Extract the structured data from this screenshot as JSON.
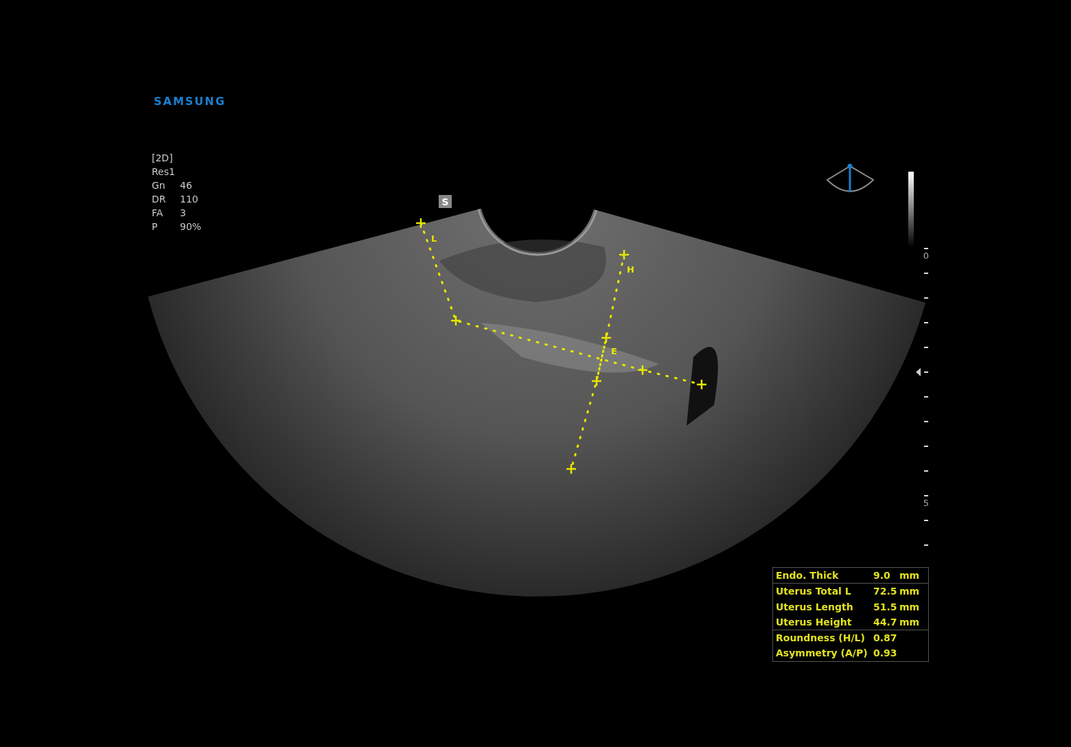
{
  "brand": "SAMSUNG",
  "mode": "[2D]",
  "parameters": [
    {
      "label": "Res1"
    },
    {
      "label": "Gn",
      "value": "46"
    },
    {
      "label": "DR",
      "value": "110"
    },
    {
      "label": "FA",
      "value": "3"
    },
    {
      "label": "P",
      "value": "90%"
    }
  ],
  "orientation_marker": "S",
  "caliper_labels": [
    {
      "label": "L"
    },
    {
      "label": "H"
    },
    {
      "label": "E"
    }
  ],
  "depth_scale": {
    "labels": [
      "0",
      "5"
    ]
  },
  "measurements": [
    [
      {
        "name": "Endo. Thick",
        "value": "9.0",
        "unit": "mm"
      }
    ],
    [
      {
        "name": "Uterus Total L",
        "value": "72.5",
        "unit": "mm"
      },
      {
        "name": "Uterus Length",
        "value": "51.5",
        "unit": "mm"
      },
      {
        "name": "Uterus Height",
        "value": "44.7",
        "unit": "mm"
      }
    ],
    [
      {
        "name": "Roundness (H/L)",
        "value": "0.87"
      },
      {
        "name": "Asymmetry (A/P)",
        "value": "0.93"
      }
    ]
  ]
}
